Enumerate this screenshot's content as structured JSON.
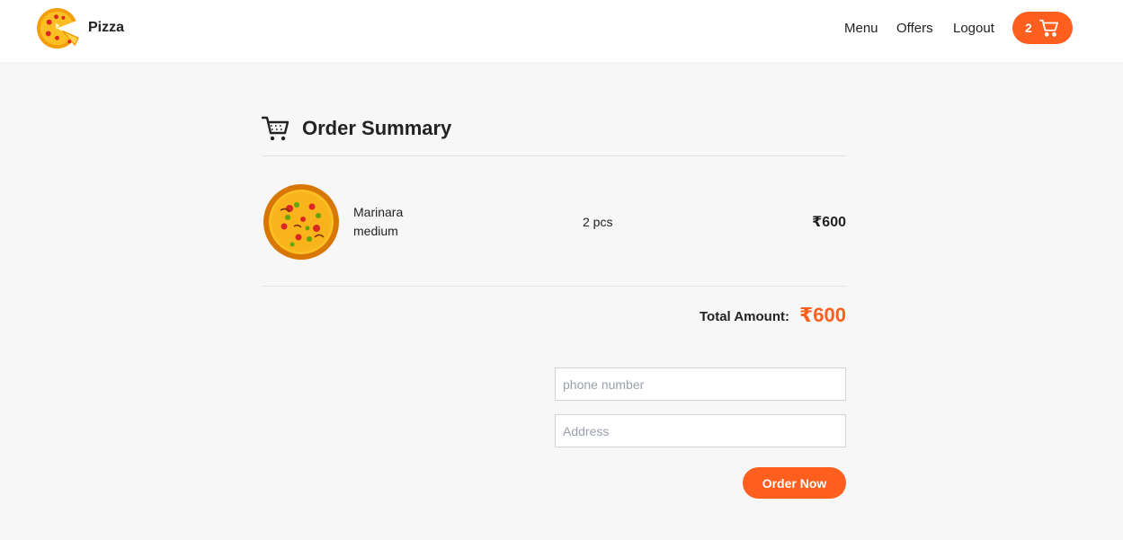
{
  "nav": {
    "brand": "Pizza",
    "links": [
      "Menu",
      "Offers",
      "Logout"
    ],
    "cart_count": "2"
  },
  "summary": {
    "title": "Order Summary"
  },
  "items": [
    {
      "name": "Marinara",
      "size": "medium",
      "qty": "2 pcs",
      "price": "₹600"
    }
  ],
  "total": {
    "label": "Total Amount:",
    "value": "₹600"
  },
  "form": {
    "phone_placeholder": "phone number",
    "address_placeholder": "Address",
    "order_label": "Order Now"
  },
  "colors": {
    "accent": "#fe5f1e",
    "page_bg": "#f7f7f7",
    "nav_bg": "#ffffff"
  },
  "icons": [
    "pizza-logo-icon",
    "cart-icon",
    "order-summary-cart-icon"
  ]
}
